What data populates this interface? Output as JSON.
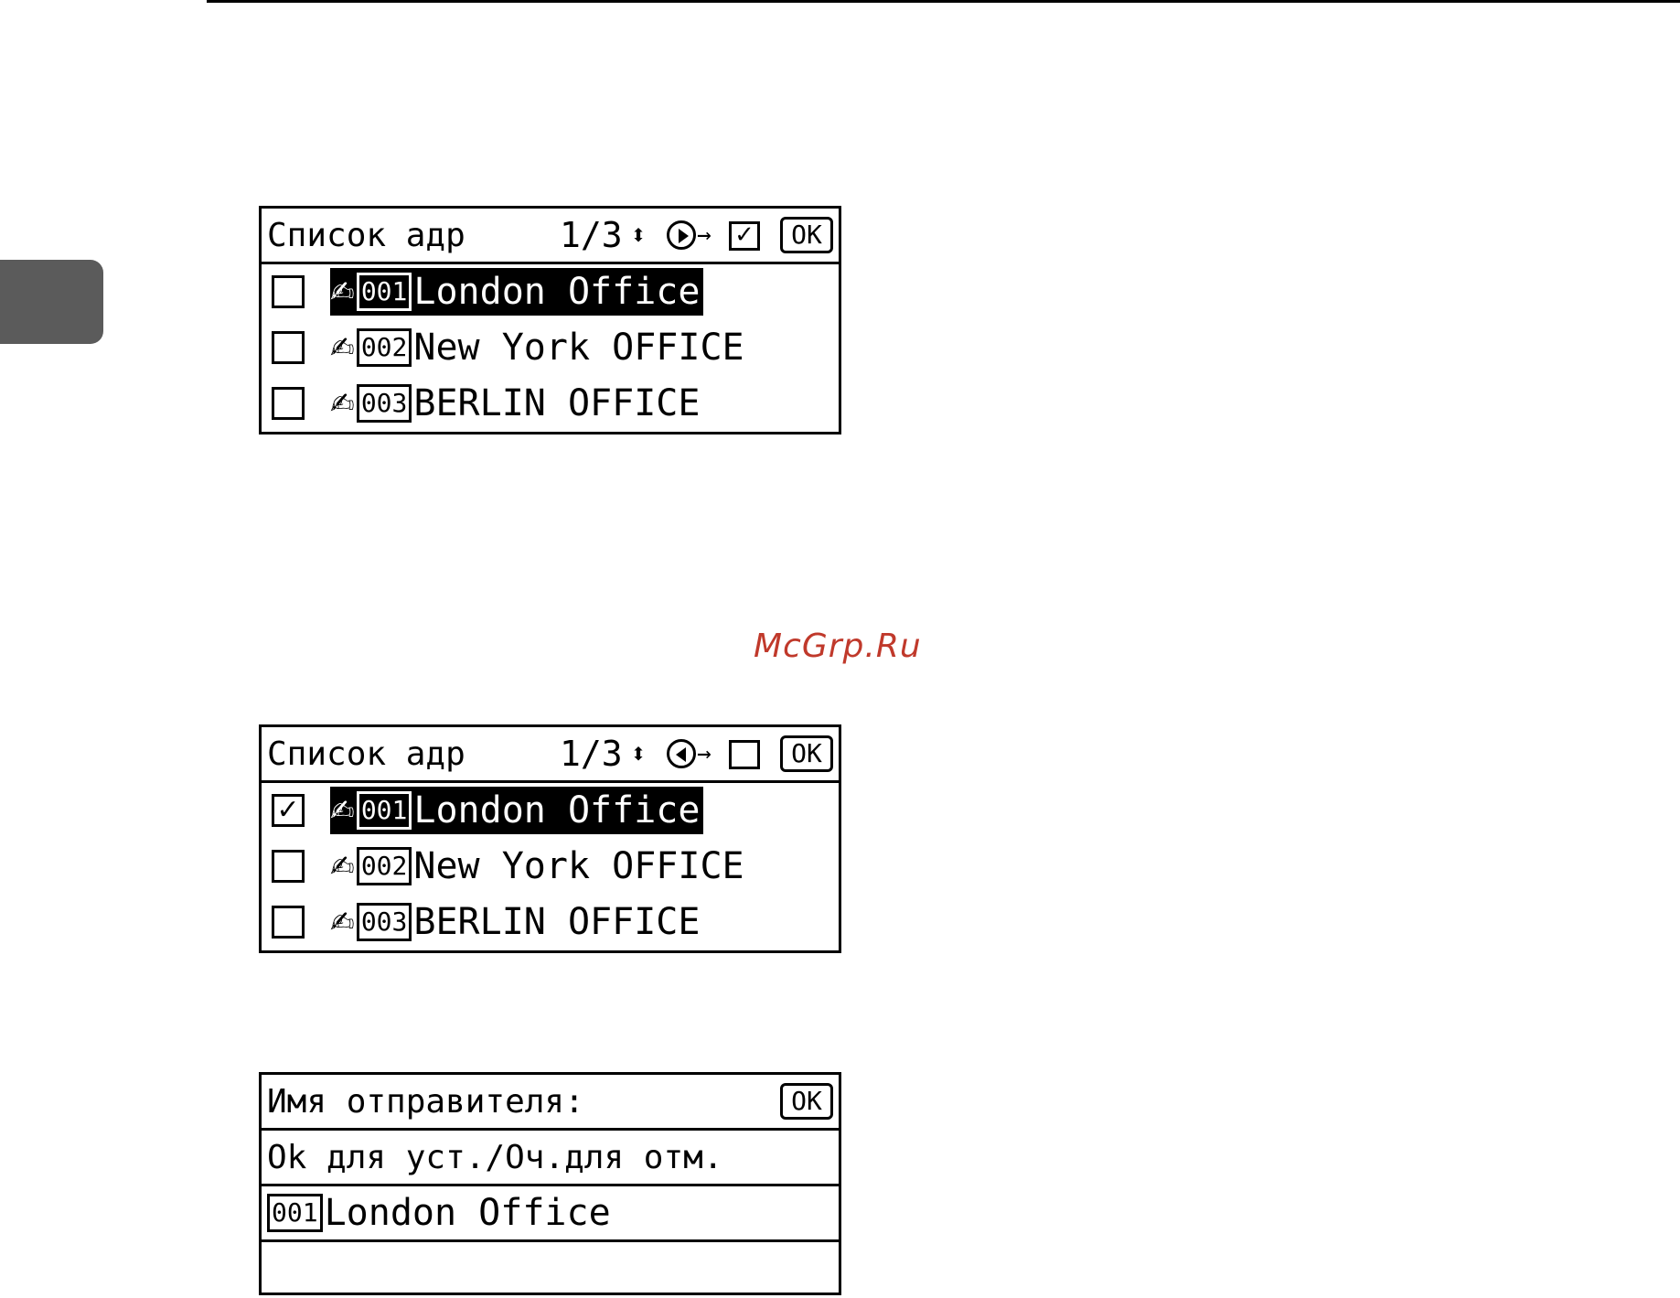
{
  "screen1": {
    "title": "Список адр",
    "page": "1/3",
    "updown_symbol": "⬍",
    "arrow": "→",
    "target_mark": "✓",
    "ok_label": "OK",
    "rows": [
      {
        "checked": "",
        "number": "001",
        "name": "London Office"
      },
      {
        "checked": "",
        "number": "002",
        "name": "New York OFFICE"
      },
      {
        "checked": "",
        "number": "003",
        "name": "BERLIN OFFICE"
      }
    ]
  },
  "screen2": {
    "title": "Список адр",
    "page": "1/3",
    "updown_symbol": "⬍",
    "arrow": "→",
    "target_mark": "",
    "ok_label": "OK",
    "rows": [
      {
        "checked": "✓",
        "number": "001",
        "name": "London Office"
      },
      {
        "checked": "",
        "number": "002",
        "name": "New York OFFICE"
      },
      {
        "checked": "",
        "number": "003",
        "name": "BERLIN OFFICE"
      }
    ]
  },
  "screen3": {
    "title": "Имя отправителя:",
    "ok_label": "OK",
    "message": "Ok для уст./Оч.для отм.",
    "sender_number": "001",
    "sender_name": "London Office"
  },
  "watermark": "McGrp.Ru",
  "colors": {
    "watermark": "#c0392b",
    "side_tab": "#5b5b5b"
  },
  "icons": {
    "entry": "address-book-hand-icon"
  }
}
